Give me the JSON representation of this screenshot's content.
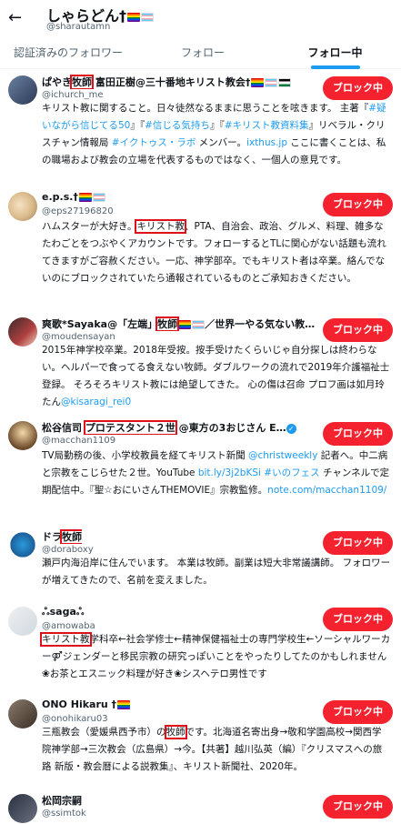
{
  "header": {
    "title": "しゃらどん†",
    "handle": "@sharautamn",
    "back_glyph": "←"
  },
  "tabs": [
    {
      "label": "認証済みのフォロワー",
      "active": false
    },
    {
      "label": "フォロー",
      "active": false
    },
    {
      "label": "フォロー中",
      "active": true
    }
  ],
  "button_label": "ブロック中",
  "users": [
    {
      "name_pre": "ぱやき",
      "name_hl": "牧師",
      "name_post": " 富田正樹@三十番地キリスト教会†",
      "handle": "@ichurch_me",
      "bio": [
        {
          "t": "キリスト教に関すること。日々徒然なるままに思うことを呟きます。 主著『"
        },
        {
          "t": "#疑いながら信じてる50",
          "lk": true
        },
        {
          "t": "』『"
        },
        {
          "t": "#信じる気持ち",
          "lk": true
        },
        {
          "t": "』『"
        },
        {
          "t": "#キリスト教資料集",
          "lk": true
        },
        {
          "t": "』リベラル・クリスチャン情報局 "
        },
        {
          "t": "#イクトゥス・ラボ",
          "lk": true
        },
        {
          "t": " メンバー。"
        },
        {
          "t": "ixthus.jp",
          "lk": true
        },
        {
          "t": " ここに書くことは、私の職場および教会の立場を代表するものではなく、一個人の意見です。"
        }
      ]
    },
    {
      "name_pre": "e.p.s.†",
      "name_hl": "",
      "name_post": "",
      "handle": "@eps27196820",
      "bio": [
        {
          "t": "ハムスターが大好き。"
        },
        {
          "t": "キリスト教",
          "hl": true
        },
        {
          "t": "、PTA、自治会、政治、グルメ、料理、雑多なたわごとをつぶやくアカウントです。フォローするとTLに関心がない話題も流れてきますがご容赦ください。一応、神学部卒。でもキリスト者は卒業。絡んでないのにブロックされていたら通報されているものとご承知おきください。"
        }
      ]
    },
    {
      "name_pre": "爽歌*Sayaka@「左端」",
      "name_hl": "牧師",
      "name_post": "／世界一やる気ない教…",
      "handle": "@moudensayan",
      "bio": [
        {
          "t": "2015年神学校卒業。2018年受按。按手受けたくらいじゃ自分探しは終わらない。ヘルパーで食ってる食えない牧師。ダブルワークの流れで2019年介護福祉士登録。 そろそろキリスト教には絶望してきた。 心の傷は召命 プロフ画は如月玲たん"
        },
        {
          "t": "@kisaragi_rei0",
          "lk": true
        }
      ]
    },
    {
      "name_pre": "松谷信司 ",
      "name_hl": "プロテスタント２世",
      "name_post": " @東方の3おじさん E…",
      "handle": "@macchan1109",
      "verified": true,
      "bio": [
        {
          "t": "TV局勤務の後、小学校教員を経てキリスト新聞 "
        },
        {
          "t": "@christweekly",
          "lk": true
        },
        {
          "t": " 記者へ。中二病と宗教をこじらせた２世。YouTube "
        },
        {
          "t": "bit.ly/3j2bKSi",
          "lk": true
        },
        {
          "t": " "
        },
        {
          "t": "#いのフェス",
          "lk": true
        },
        {
          "t": " チャンネルで定期配信中。『聖☆おにいさんTHEMOVIE』宗教監修。"
        },
        {
          "t": "note.com/macchan1109/",
          "lk": true
        }
      ]
    },
    {
      "name_pre": "ドラ",
      "name_hl": "牧師",
      "name_post": "",
      "handle": "@doraboxy",
      "bio": [
        {
          "t": "瀬戸内海沿岸に住んでいます。 本業は牧師。副業は短大非常議講師。 フォロワーが増えてきたので、名前を変えました。"
        }
      ]
    },
    {
      "name_pre": "ஃsagaஃ",
      "name_hl": "",
      "name_post": "",
      "handle": "@amowaba",
      "bio": [
        {
          "t": "キリスト教",
          "hl": true
        },
        {
          "t": "学科卒←社会学修士←精神保健福祉士の専門学校生←ソーシャルワーカー⚤ジェンダーと移民宗教の研究っぽいことをやったりしてたのかもしれません❀お茶とエスニック料理が好き❀シスヘテロ男性です"
        }
      ]
    },
    {
      "name_pre": "ONO Hikaru †",
      "name_hl": "",
      "name_post": "",
      "handle": "@onohikaru03",
      "bio": [
        {
          "t": "三瓶教会（愛媛県西予市）の"
        },
        {
          "t": "牧師",
          "hl": true
        },
        {
          "t": "です。北海道名寄出身→敬和学園高校→関西学院神学部→三次教会（広島県）→今。【共著】越川弘英（編）『クリスマスへの旅路 新版・教会暦による説教集』、キリスト新聞社、2020年。"
        }
      ]
    },
    {
      "name_pre": "松岡宗嗣",
      "name_hl": "",
      "name_post": "",
      "handle": "@ssimtok",
      "bio": []
    }
  ]
}
